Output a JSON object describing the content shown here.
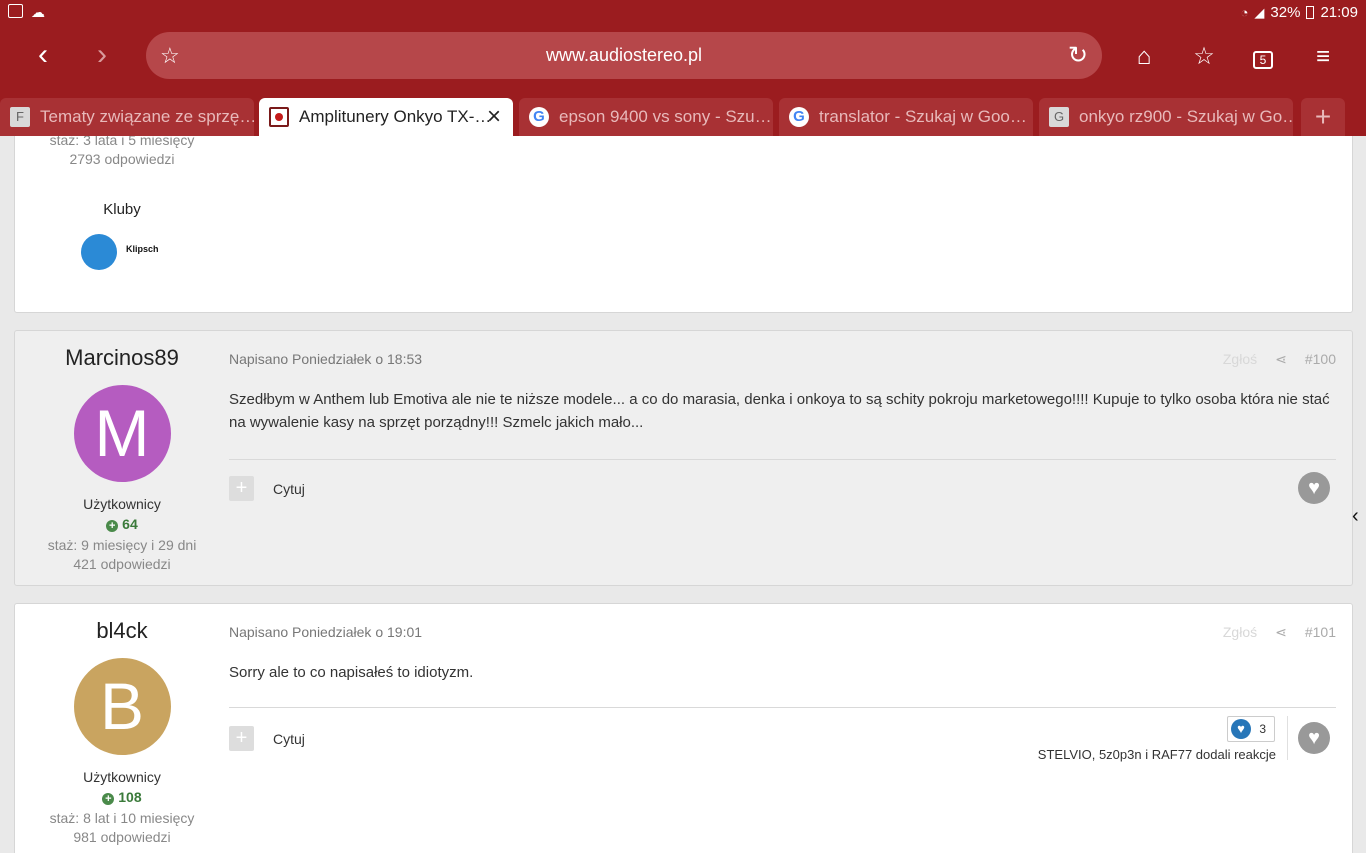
{
  "status_bar": {
    "battery": "32%",
    "time": "21:09"
  },
  "browser": {
    "url": "www.audiostereo.pl",
    "tab_count": "5",
    "tabs": [
      {
        "label": "Tematy związane ze sprzę…",
        "favicon": "F"
      },
      {
        "label": "Amplitunery Onkyo TX-…",
        "favicon": ""
      },
      {
        "label": "epson 9400 vs sony - Szu…",
        "favicon": "G"
      },
      {
        "label": "translator - Szukaj w Goo…",
        "favicon": "G"
      },
      {
        "label": "onkyo rz900 - Szukaj w Go…",
        "favicon": "G"
      }
    ]
  },
  "prev_post": {
    "meta_tenure": "staż: 3 lata i 5 miesięcy",
    "meta_replies": "2793 odpowiedzi",
    "clubs_label": "Kluby",
    "club_badge_text": "Klipsch"
  },
  "posts": [
    {
      "author": "Marcinos89",
      "avatar_letter": "M",
      "avatar_color": "#b55cc0",
      "role": "Użytkownicy",
      "reputation": "64",
      "tenure": "staż: 9 miesięcy i 29 dni",
      "replies": "421 odpowiedzi",
      "posted": "Napisano Poniedziałek o 18:53",
      "report": "Zgłoś",
      "number": "#100",
      "body": "Szedłbym w Anthem lub Emotiva ale nie te niższe modele... a co do marasia, denka i onkoya to są schity pokroju marketowego!!!! Kupuje to tylko osoba która nie stać na wywalenie kasy na sprzęt porządny!!!  Szmelc jakich mało...",
      "quote_label": "Cytuj"
    },
    {
      "author": "bl4ck",
      "avatar_letter": "B",
      "avatar_color": "#c9a460",
      "role": "Użytkownicy",
      "reputation": "108",
      "tenure": "staż: 8 lat i 10 miesięcy",
      "replies": "981 odpowiedzi",
      "posted": "Napisano Poniedziałek o 19:01",
      "report": "Zgłoś",
      "number": "#101",
      "body": "Sorry ale to co napisałeś to idiotyzm.",
      "quote_label": "Cytuj",
      "reaction_count": "3",
      "reacted_by": "STELVIO, 5z0p3n i RAF77 dodali reakcje"
    }
  ],
  "icons": {
    "back": "back-arrow-icon",
    "forward": "forward-arrow-icon",
    "home": "home-icon",
    "bookmarks": "bookmarks-icon",
    "tabs": "tabs-icon",
    "menu": "menu-icon"
  }
}
